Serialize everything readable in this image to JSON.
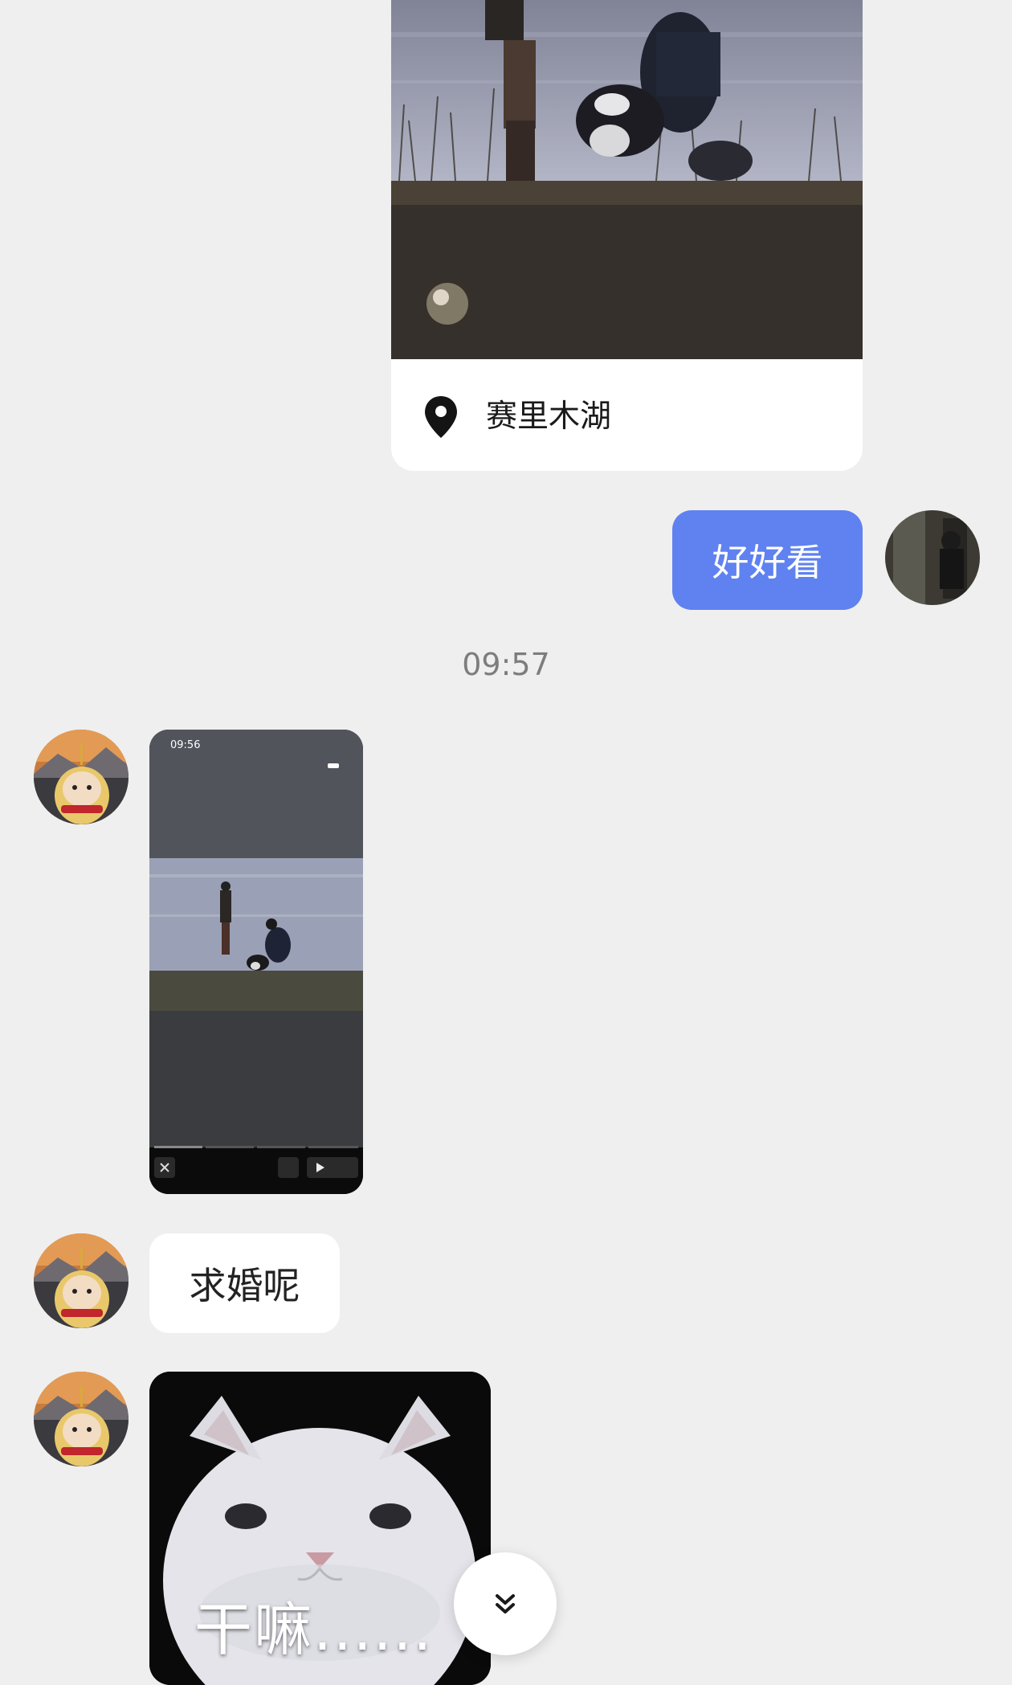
{
  "location_card": {
    "place_name": "赛里木湖",
    "icon": "map-pin-icon"
  },
  "outgoing_message": {
    "text": "好好看"
  },
  "timestamp": "09:57",
  "video_message": {
    "status_time": "09:56"
  },
  "incoming_message": {
    "text": "求婚呢"
  },
  "sticker": {
    "caption": "干嘛......"
  },
  "scroll_button": {
    "icon": "double-chevron-down-icon"
  },
  "colors": {
    "background": "#efefef",
    "outgoing_bubble": "#5f82f0",
    "incoming_bubble": "#ffffff",
    "timestamp_text": "#7d7d7d"
  }
}
